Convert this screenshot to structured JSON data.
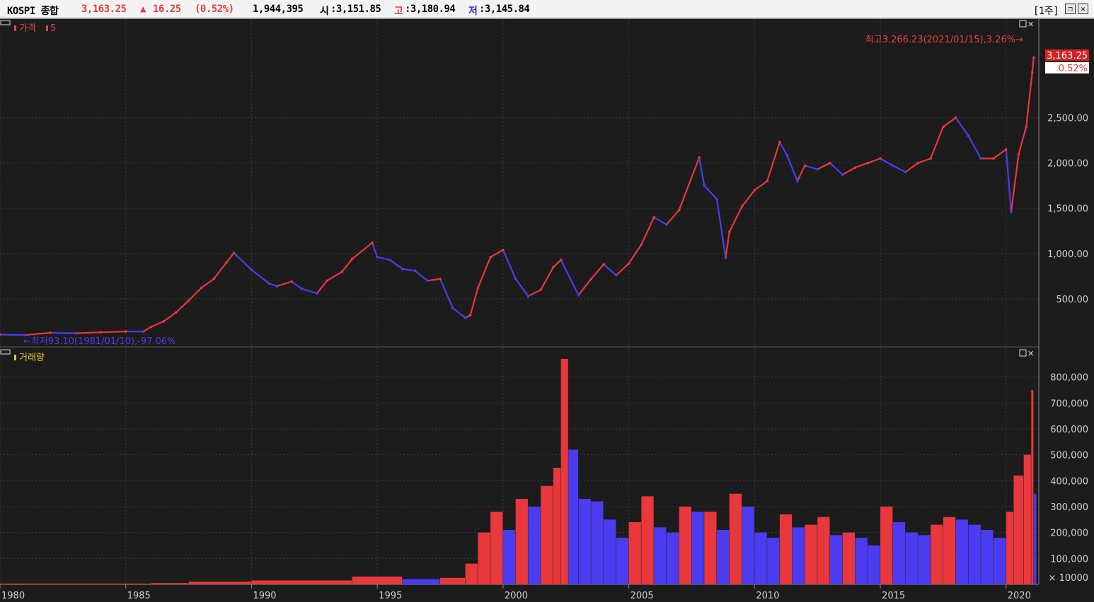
{
  "header": {
    "symbol": "KOSPI 종합",
    "price": "3,163.25",
    "change_arrow": "▲",
    "change": "16.25",
    "change_pct": "(0.52%)",
    "volume": "1,944,395",
    "open_label": "시",
    "open_value": ":3,151.85",
    "high_label": "고",
    "high_value": ":3,180.94",
    "low_label": "저",
    "low_value": ":3,145.84",
    "period": "[1주]"
  },
  "price_panel": {
    "legend_price": "가격",
    "legend_ma": "5",
    "max_annotation": "최고3,266.23(2021/01/15),3.26%→",
    "min_annotation": "←최저93.10(1981/01/10),-97.06%",
    "current_price_tag": "3,163.25",
    "current_pct_tag": "0.52%"
  },
  "volume_panel": {
    "legend_volume": "거래량",
    "unit_label": "× 10000"
  },
  "colors": {
    "up": "#e8383c",
    "down": "#4b3cf0",
    "background": "#1c1c1c",
    "axis_text": "#d0d0d0",
    "legend_price": "#e84848",
    "legend_volume": "#e8c830"
  },
  "chart_data": [
    {
      "type": "line",
      "title": "",
      "series": [
        {
          "name": "가격",
          "x": [
            1980.0,
            1981.0,
            1982.0,
            1983.0,
            1984.0,
            1985.0,
            1985.7,
            1986.0,
            1986.5,
            1987.0,
            1987.5,
            1988.0,
            1988.5,
            1989.0,
            1989.3,
            1990.0,
            1990.7,
            1991.0,
            1991.6,
            1992.0,
            1992.6,
            1993.0,
            1993.6,
            1994.0,
            1994.8,
            1995.0,
            1995.5,
            1996.0,
            1996.5,
            1997.0,
            1997.5,
            1998.0,
            1998.5,
            1998.7,
            1999.0,
            1999.5,
            2000.0,
            2000.5,
            2001.0,
            2001.5,
            2002.0,
            2002.3,
            2003.0,
            2003.5,
            2004.0,
            2004.5,
            2005.0,
            2005.5,
            2006.0,
            2006.5,
            2007.0,
            2007.8,
            2008.0,
            2008.5,
            2008.85,
            2009.0,
            2009.5,
            2010.0,
            2010.5,
            2011.0,
            2011.3,
            2011.7,
            2012.0,
            2012.5,
            2013.0,
            2013.5,
            2014.0,
            2014.5,
            2015.0,
            2015.5,
            2016.0,
            2016.5,
            2017.0,
            2017.5,
            2018.0,
            2018.5,
            2019.0,
            2019.5,
            2020.0,
            2020.2,
            2020.5,
            2020.8,
            2021.04,
            2021.1
          ],
          "y": [
            106,
            100,
            125,
            120,
            130,
            140,
            138,
            190,
            250,
            350,
            480,
            620,
            720,
            900,
            1007,
            820,
            670,
            640,
            690,
            610,
            560,
            700,
            800,
            940,
            1120,
            960,
            930,
            830,
            810,
            700,
            720,
            400,
            290,
            320,
            620,
            960,
            1040,
            720,
            530,
            600,
            850,
            930,
            540,
            720,
            880,
            760,
            890,
            1100,
            1400,
            1320,
            1480,
            2060,
            1750,
            1600,
            950,
            1240,
            1520,
            1700,
            1800,
            2230,
            2080,
            1800,
            1970,
            1930,
            2000,
            1870,
            1950,
            2000,
            2050,
            1970,
            1900,
            2000,
            2050,
            2400,
            2500,
            2300,
            2050,
            2050,
            2150,
            1460,
            2100,
            2400,
            3000,
            3163
          ]
        }
      ],
      "ylim": [
        0,
        3550
      ],
      "yticks": [
        "500.00",
        "1,000.00",
        "1,500.00",
        "2,000.00",
        "2,500.00"
      ]
    },
    {
      "type": "bar",
      "title": "",
      "series": [
        {
          "name": "거래량",
          "x": [
            1980,
            1986,
            1987.5,
            1990,
            1994,
            1996,
            1997.5,
            1998.5,
            1999.0,
            1999.5,
            2000.0,
            2000.5,
            2001.0,
            2001.5,
            2002.0,
            2002.3,
            2002.6,
            2003.0,
            2003.5,
            2004.0,
            2004.5,
            2005.0,
            2005.5,
            2006.0,
            2006.5,
            2007.0,
            2007.5,
            2008.0,
            2008.5,
            2009.0,
            2009.5,
            2010.0,
            2010.5,
            2011.0,
            2011.5,
            2012.0,
            2012.5,
            2013.0,
            2013.5,
            2014.0,
            2014.5,
            2015.0,
            2015.5,
            2016.0,
            2016.5,
            2017.0,
            2017.5,
            2018.0,
            2018.5,
            2019.0,
            2019.5,
            2020.0,
            2020.3,
            2020.7,
            2021.0,
            2021.1
          ],
          "values": [
            3,
            5,
            10,
            15,
            30,
            20,
            25,
            80,
            200,
            280,
            210,
            330,
            300,
            380,
            450,
            870,
            520,
            330,
            320,
            250,
            180,
            240,
            340,
            220,
            200,
            300,
            280,
            280,
            210,
            350,
            300,
            200,
            180,
            270,
            220,
            230,
            260,
            190,
            200,
            180,
            150,
            300,
            240,
            200,
            190,
            230,
            260,
            250,
            230,
            210,
            180,
            280,
            420,
            500,
            750,
            350
          ]
        }
      ],
      "ylim": [
        0,
        900
      ],
      "yticks": [
        "100,000",
        "200,000",
        "300,000",
        "400,000",
        "500,000",
        "600,000",
        "700,000",
        "800,000"
      ]
    }
  ],
  "x_axis": {
    "range": [
      1980,
      2021.3
    ],
    "ticks": [
      "1980",
      "1985",
      "1990",
      "1995",
      "2000",
      "2005",
      "2010",
      "2015",
      "2020"
    ]
  }
}
